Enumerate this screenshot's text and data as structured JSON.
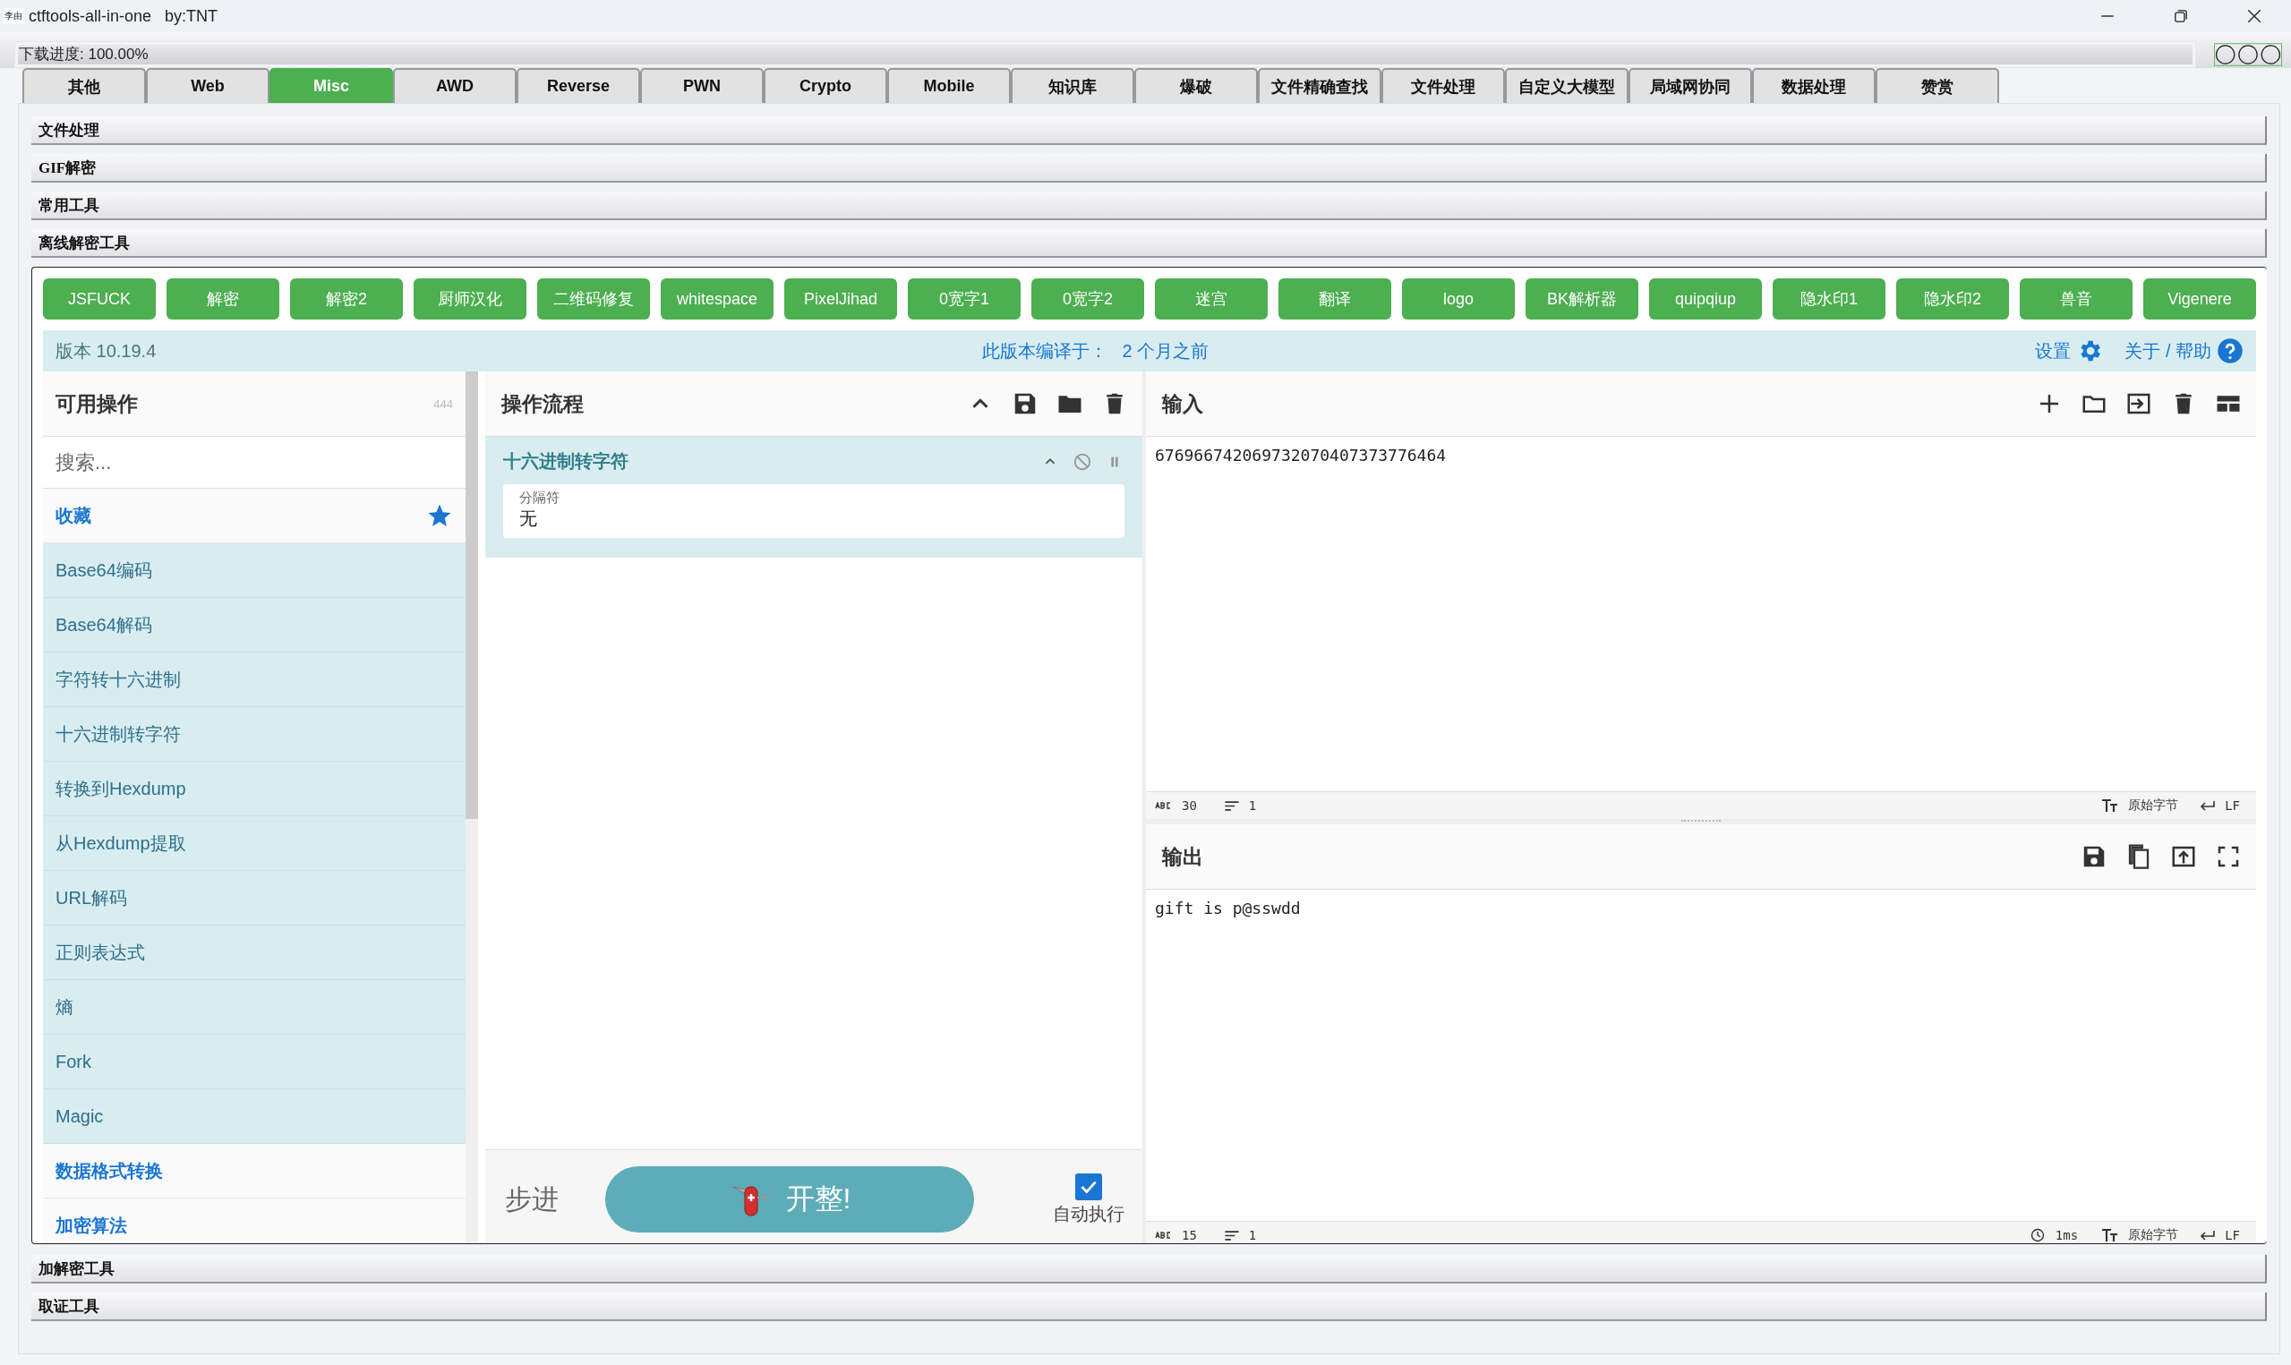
{
  "window": {
    "app_icon": "李由",
    "title": "ctftools-all-in-one   by:TNT"
  },
  "download": {
    "label": "下载进度: 100.00%",
    "level": 1
  },
  "tabs": [
    {
      "label": "其他",
      "selected": false
    },
    {
      "label": "Web",
      "selected": false
    },
    {
      "label": "Misc",
      "selected": true
    },
    {
      "label": "AWD",
      "selected": false
    },
    {
      "label": "Reverse",
      "selected": false
    },
    {
      "label": "PWN",
      "selected": false
    },
    {
      "label": "Crypto",
      "selected": false
    },
    {
      "label": "Mobile",
      "selected": false
    },
    {
      "label": "知识库",
      "selected": false
    },
    {
      "label": "爆破",
      "selected": false
    },
    {
      "label": "文件精确查找",
      "selected": false
    },
    {
      "label": "文件处理",
      "selected": false
    },
    {
      "label": "自定义大模型",
      "selected": false
    },
    {
      "label": "局域网协同",
      "selected": false
    },
    {
      "label": "数据处理",
      "selected": false
    },
    {
      "label": "赞赏",
      "selected": false
    }
  ],
  "sections_above": [
    "文件处理",
    "GIF解密",
    "常用工具",
    "离线解密工具"
  ],
  "sections_below": [
    "加解密工具",
    "取证工具"
  ],
  "tool_buttons": [
    "JSFUCK",
    "解密",
    "解密2",
    "厨师汉化",
    "二维码修复",
    "whitespace",
    "PixelJihad",
    "0宽字1",
    "0宽字2",
    "迷宫",
    "翻译",
    "logo",
    "BK解析器",
    "quipqiup",
    "隐水印1",
    "隐水印2",
    "兽音",
    "Vigenere"
  ],
  "info_bar": {
    "version": "版本 10.19.4",
    "build_label": "此版本编译于：",
    "build_age": "2 个月之前",
    "settings": "设置",
    "about": "关于 / 帮助"
  },
  "operations": {
    "title": "可用操作",
    "count": "444",
    "search_placeholder": "搜索...",
    "categories": [
      {
        "name": "收藏",
        "expanded": true,
        "items": [
          "Base64编码",
          "Base64解码",
          "字符转十六进制",
          "十六进制转字符",
          "转换到Hexdump",
          "从Hexdump提取",
          "URL解码",
          "正则表达式",
          "熵",
          "Fork",
          "Magic"
        ]
      },
      {
        "name": "数据格式转换",
        "expanded": false
      },
      {
        "name": "加密算法",
        "expanded": false
      }
    ]
  },
  "recipe": {
    "title": "操作流程",
    "operations": [
      {
        "name": "十六进制转字符",
        "args": [
          {
            "label": "分隔符",
            "value": "无"
          }
        ]
      }
    ]
  },
  "controls": {
    "step": "步进",
    "bake": "开整!",
    "auto_bake": {
      "label": "自动执行",
      "checked": true
    }
  },
  "input": {
    "title": "输入",
    "value": "676966742069732070407373776464",
    "status": {
      "chars": "30",
      "lines": "1",
      "encoding": "原始字节",
      "eol": "LF"
    }
  },
  "output": {
    "title": "输出",
    "value": "gift is p@sswdd",
    "status": {
      "time": "1ms",
      "chars": "15",
      "lines": "1",
      "encoding": "原始字节",
      "eol": "LF"
    }
  }
}
